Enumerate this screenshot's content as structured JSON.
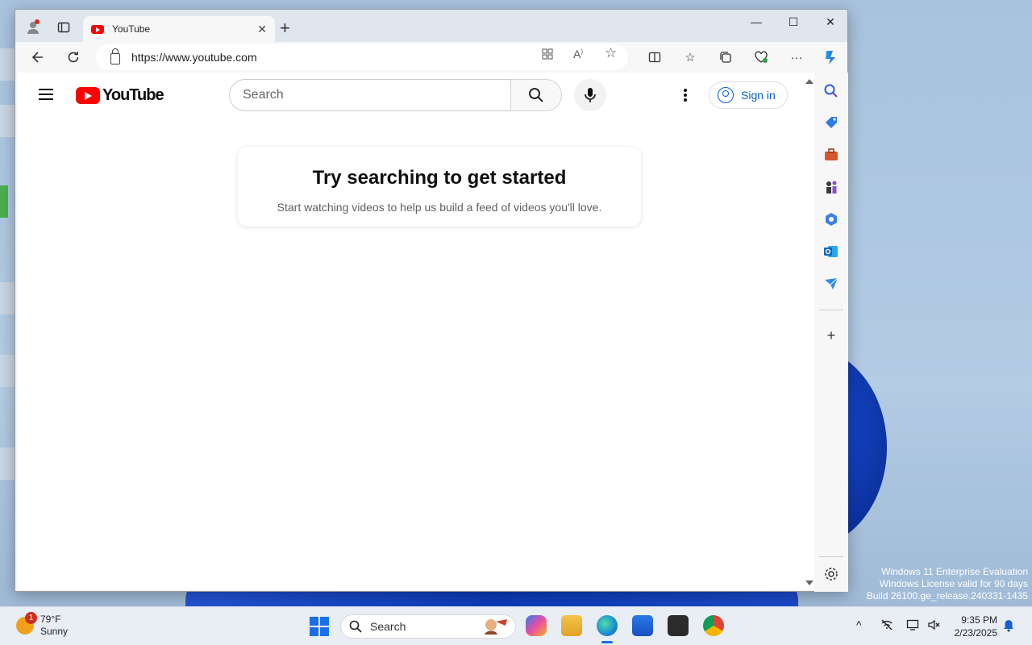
{
  "browser": {
    "tab_title": "YouTube",
    "url": "https://www.youtube.com",
    "window_controls": [
      "—",
      "☐",
      "✕"
    ]
  },
  "youtube": {
    "logo_text": "YouTube",
    "search_placeholder": "Search",
    "sign_in_label": "Sign in",
    "card_title": "Try searching to get started",
    "card_subtitle": "Start watching videos to help us build a feed of videos you'll love."
  },
  "desktop": {
    "watermark_line1": "Windows 11 Enterprise Evaluation",
    "watermark_line2": "Windows License valid for 90 days",
    "watermark_line3": "Build 26100.ge_release.240331-1435"
  },
  "taskbar": {
    "weather_badge": "1",
    "weather_temp": "79°F",
    "weather_desc": "Sunny",
    "search_label": "Search",
    "time": "9:35 PM",
    "date": "2/23/2025"
  },
  "colors": {
    "youtube_red": "#ff0000",
    "link_blue": "#065fd4",
    "edge_accent": "#1a6ee8"
  }
}
